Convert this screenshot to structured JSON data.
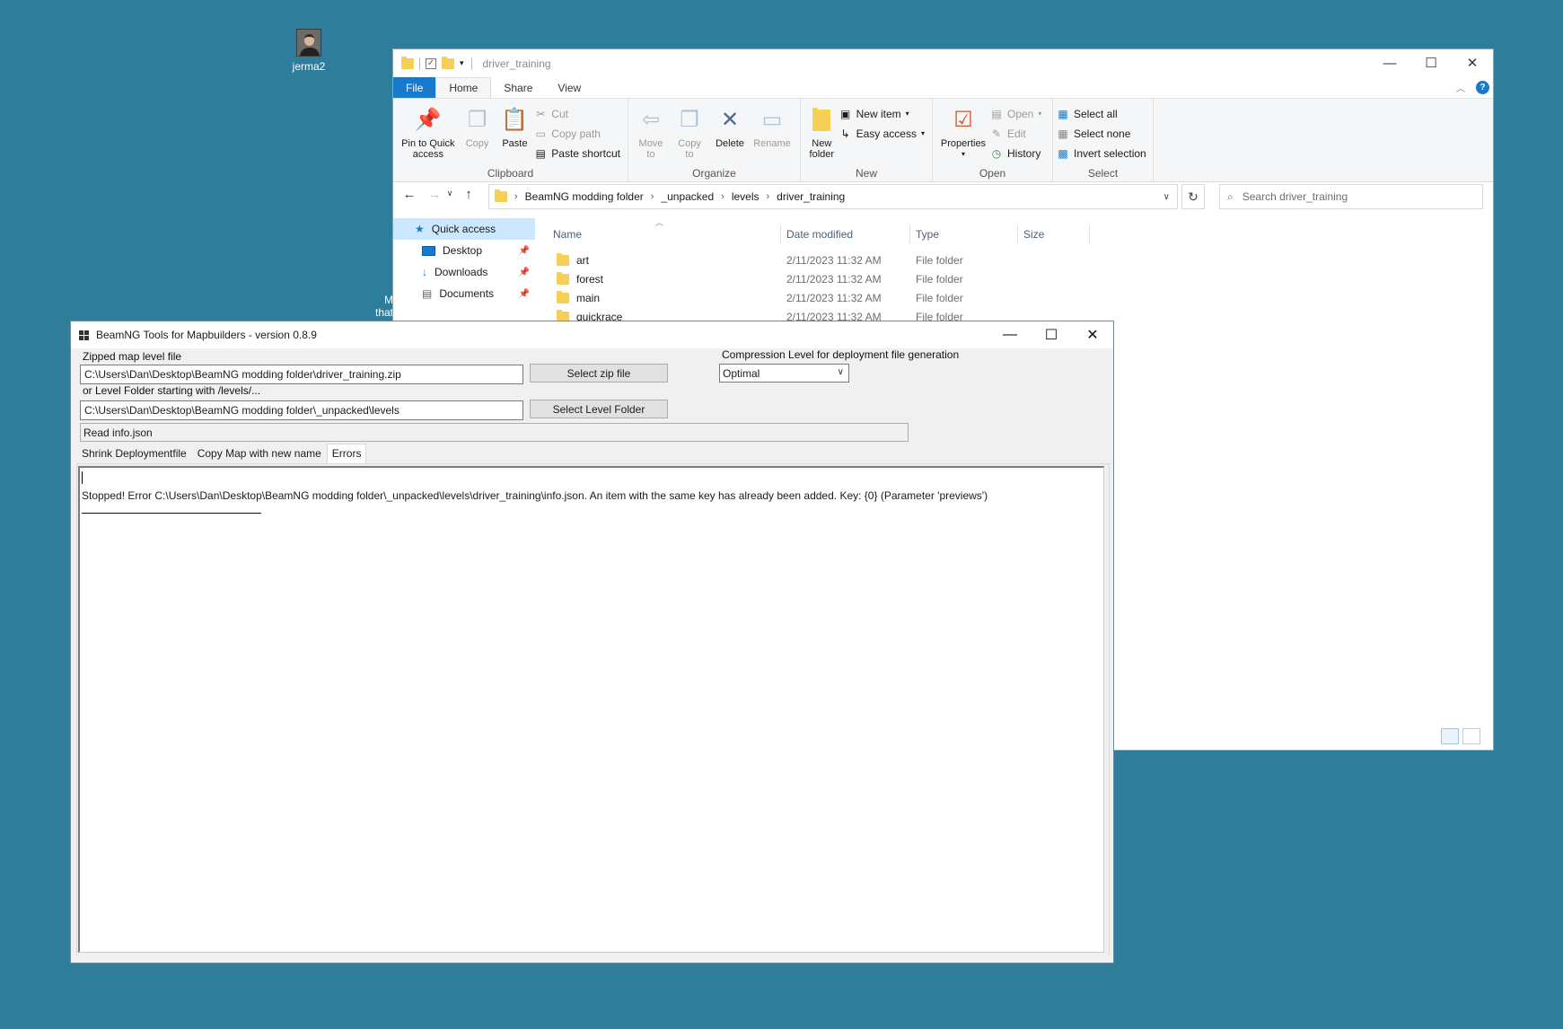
{
  "desktop": {
    "user_icon_label": "jerma2",
    "fragment1": "M",
    "fragment2": "that"
  },
  "explorer": {
    "title": "driver_training",
    "ribbon_tabs": [
      "File",
      "Home",
      "Share",
      "View"
    ],
    "clipboard": {
      "pin_label_1": "Pin to Quick",
      "pin_label_2": "access",
      "copy": "Copy",
      "paste": "Paste",
      "cut": "Cut",
      "copy_path": "Copy path",
      "paste_shortcut": "Paste shortcut",
      "group": "Clipboard"
    },
    "organize": {
      "move_to_1": "Move",
      "move_to_2": "to",
      "copy_to_1": "Copy",
      "copy_to_2": "to",
      "delete": "Delete",
      "rename": "Rename",
      "group": "Organize"
    },
    "new": {
      "new_folder_1": "New",
      "new_folder_2": "folder",
      "new_item": "New item",
      "easy_access": "Easy access",
      "group": "New"
    },
    "open": {
      "properties": "Properties",
      "open": "Open",
      "edit": "Edit",
      "history": "History",
      "group": "Open"
    },
    "select": {
      "select_all": "Select all",
      "select_none": "Select none",
      "invert": "Invert selection",
      "group": "Select"
    },
    "breadcrumb": [
      "BeamNG modding folder",
      "_unpacked",
      "levels",
      "driver_training"
    ],
    "search_placeholder": "Search driver_training",
    "nav": [
      {
        "label": "Quick access",
        "pinned": false
      },
      {
        "label": "Desktop",
        "pinned": true
      },
      {
        "label": "Downloads",
        "pinned": true
      },
      {
        "label": "Documents",
        "pinned": true
      }
    ],
    "columns": {
      "name": "Name",
      "date": "Date modified",
      "type": "Type",
      "size": "Size"
    },
    "files": [
      {
        "name": "art",
        "date": "2/11/2023 11:32 AM",
        "type": "File folder"
      },
      {
        "name": "forest",
        "date": "2/11/2023 11:32 AM",
        "type": "File folder"
      },
      {
        "name": "main",
        "date": "2/11/2023 11:32 AM",
        "type": "File folder"
      },
      {
        "name": "quickrace",
        "date": "2/11/2023 11:32 AM",
        "type": "File folder"
      }
    ]
  },
  "tool": {
    "title": "BeamNG Tools for Mapbuilders - version 0.8.9",
    "zip_label": "Zipped map level file",
    "zip_path": "C:\\Users\\Dan\\Desktop\\BeamNG modding folder\\driver_training.zip",
    "select_zip": "Select zip file",
    "folder_label": "or Level Folder starting with /levels/...",
    "folder_path": "C:\\Users\\Dan\\Desktop\\BeamNG modding folder\\_unpacked\\levels",
    "select_folder": "Select Level Folder",
    "compression_label": "Compression Level for deployment file generation",
    "compression_value": "Optimal",
    "status": "Read info.json",
    "tabs": [
      "Shrink Deploymentfile",
      "Copy Map with new name",
      "Errors"
    ],
    "error_text": "Stopped! Error C:\\Users\\Dan\\Desktop\\BeamNG modding folder\\_unpacked\\levels\\driver_training\\info.json. An item with the same key has already been added. Key: {0} (Parameter 'previews')"
  }
}
